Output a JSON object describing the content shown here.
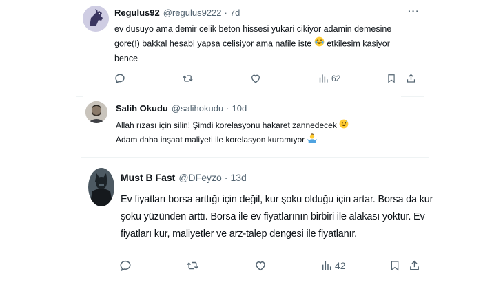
{
  "tweets": [
    {
      "name": "Regulus92",
      "handle": "@regulus9222",
      "dot": "·",
      "time": "7d",
      "text_lines": [
        "ev dusuyo ama demir celik beton hissesi yukari cikiyor adamin demesine",
        "gore(!) bakkal hesabi yapsa celisiyor ama nafile iste",
        "etkilesim kasiyor",
        "bence"
      ],
      "emoji": "laughing-crying-emoji",
      "views": "62",
      "icons": [
        "reply-icon",
        "retweet-icon",
        "like-icon",
        "views-icon",
        "bookmark-icon",
        "share-icon"
      ]
    },
    {
      "name": "Salih Okudu",
      "handle": "@salihokudu",
      "dot": "·",
      "time": "10d",
      "text_lines": [
        "Allah rızası için silin! Şimdi korelasyonu hakaret zannedecek",
        "Adam daha inşaat maliyeti ile korelasyon kuramıyor"
      ],
      "emojis": [
        "grinning-sweat-emoji",
        "person-shrugging-emoji"
      ]
    },
    {
      "name": "Must B Fast",
      "handle": "@DFeyzo",
      "dot": "·",
      "time": "13d",
      "text_lines": [
        "Ev fiyatları borsa arttığı için değil, kur şoku olduğu için artar. Borsa da kur",
        "şoku yüzünden arttı. Borsa ile ev fiyatlarının birbiri ile alakası yoktur. Ev",
        "fiyatları kur, maliyetler ve arz-talep dengesi ile fiyatlanır."
      ],
      "views": "42",
      "icons": [
        "reply-icon",
        "retweet-icon",
        "like-icon",
        "views-icon",
        "bookmark-icon",
        "share-icon"
      ]
    }
  ],
  "more_label": "···",
  "colors": {
    "text": "#0f1419",
    "secondary": "#536471",
    "divider": "#eff3f4"
  }
}
